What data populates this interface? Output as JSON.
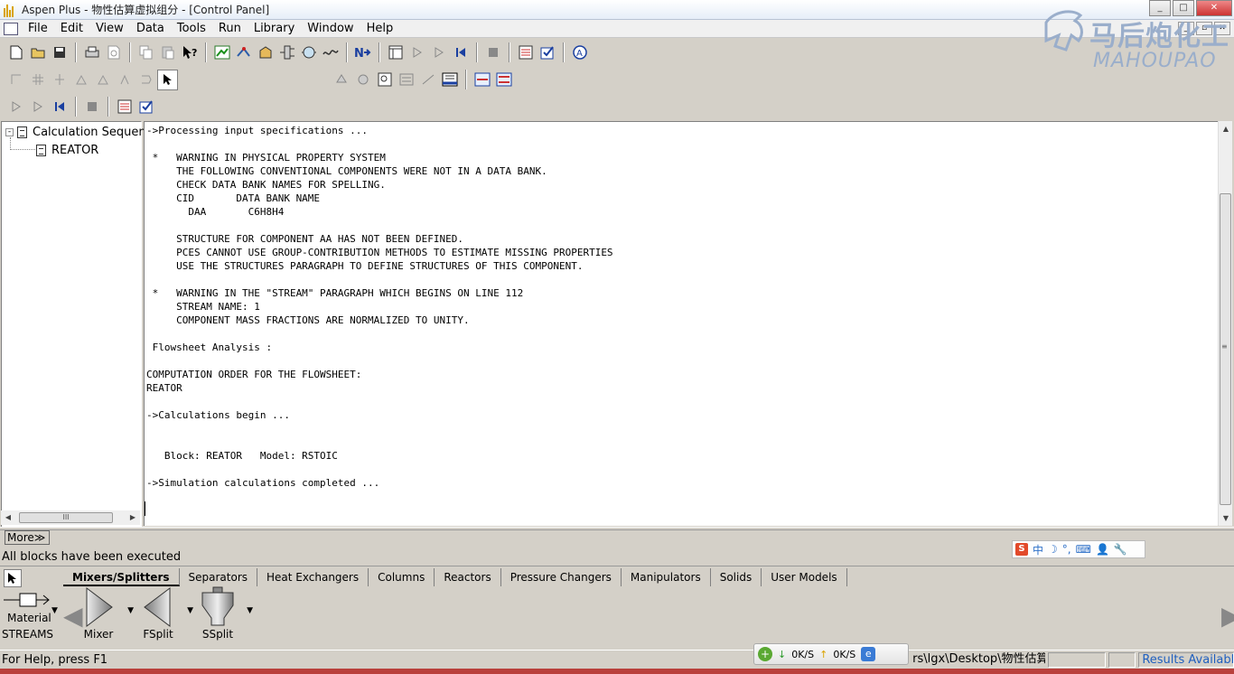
{
  "window": {
    "title": "Aspen Plus - 物性估算虚拟组分 - [Control Panel]",
    "minimize": "_",
    "maximize": "□",
    "close": "✕"
  },
  "menu": [
    "File",
    "Edit",
    "View",
    "Data",
    "Tools",
    "Run",
    "Library",
    "Window",
    "Help"
  ],
  "watermark": {
    "line1": "马后炮化工",
    "line2": "MAHOUPAO"
  },
  "tree": {
    "root": "Calculation Sequen",
    "expander": "-",
    "child": "REATOR",
    "hscroll_grip": "III"
  },
  "console_lines": [
    "->Processing input specifications ...",
    "",
    " *   WARNING IN PHYSICAL PROPERTY SYSTEM",
    "     THE FOLLOWING CONVENTIONAL COMPONENTS WERE NOT IN A DATA BANK.",
    "     CHECK DATA BANK NAMES FOR SPELLING.",
    "     CID       DATA BANK NAME",
    "       DAA       C6H8H4",
    "",
    "     STRUCTURE FOR COMPONENT AA HAS NOT BEEN DEFINED.",
    "     PCES CANNOT USE GROUP-CONTRIBUTION METHODS TO ESTIMATE MISSING PROPERTIES",
    "     USE THE STRUCTURES PARAGRAPH TO DEFINE STRUCTURES OF THIS COMPONENT.",
    "",
    " *   WARNING IN THE \"STREAM\" PARAGRAPH WHICH BEGINS ON LINE 112",
    "     STREAM NAME: 1",
    "     COMPONENT MASS FRACTIONS ARE NORMALIZED TO UNITY.",
    "",
    " Flowsheet Analysis :",
    "",
    "COMPUTATION ORDER FOR THE FLOWSHEET:",
    "REATOR",
    "",
    "->Calculations begin ...",
    "",
    "",
    "   Block: REATOR   Model: RSTOIC",
    "",
    "->Simulation calculations completed ..."
  ],
  "more_button": "More≫",
  "status_message": "All blocks have been executed",
  "ime": {
    "logo": "S",
    "mode": "中",
    "items": [
      "☽",
      "°,",
      "⌨",
      "👤",
      "🔧"
    ]
  },
  "palette": {
    "tabs": [
      "Mixers/Splitters",
      "Separators",
      "Heat Exchangers",
      "Columns",
      "Reactors",
      "Pressure Changers",
      "Manipulators",
      "Solids",
      "User Models"
    ],
    "active_tab": "Mixers/Splitters",
    "stream_label": "Material",
    "streams_caption": "STREAMS",
    "models": [
      "Mixer",
      "FSplit",
      "SSplit"
    ]
  },
  "netmon": {
    "down": "0K/S",
    "up": "0K/S"
  },
  "statusbar": {
    "help": "For Help, press F1",
    "path": "rs\\lgx\\Desktop\\物性估算",
    "results": "Results Available"
  }
}
